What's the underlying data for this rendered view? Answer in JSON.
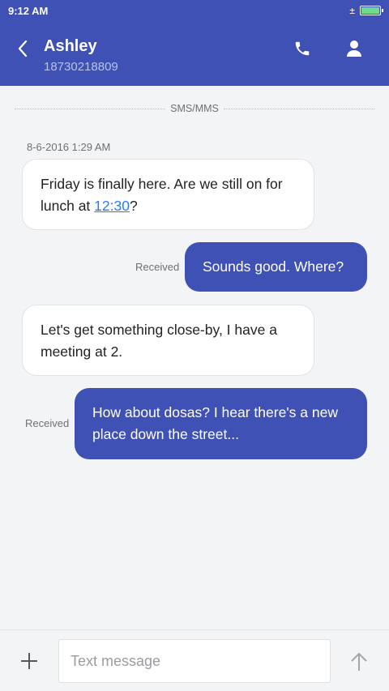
{
  "status_bar": {
    "time": "9:12 AM",
    "signal_icon": "±"
  },
  "header": {
    "contact_name": "Ashley",
    "contact_number": "18730218809"
  },
  "thread": {
    "channel_label": "SMS/MMS",
    "timestamp": "8-6-2016 1:29 AM",
    "messages": [
      {
        "direction": "incoming",
        "text_before_link": "Friday is finally here. Are we still on for lunch at ",
        "link_text": "12:30",
        "text_after_link": "?"
      },
      {
        "direction": "outgoing",
        "status": "Received",
        "text": "Sounds good. Where?"
      },
      {
        "direction": "incoming",
        "text": "Let's get something close-by, I have a meeting at 2."
      },
      {
        "direction": "outgoing",
        "status": "Received",
        "text": "How about dosas? I hear there's a new place down the street..."
      }
    ]
  },
  "composer": {
    "placeholder": "Text message",
    "value": ""
  },
  "colors": {
    "accent": "#3f51b5",
    "background": "#f3f4f6",
    "link": "#2979ff"
  }
}
